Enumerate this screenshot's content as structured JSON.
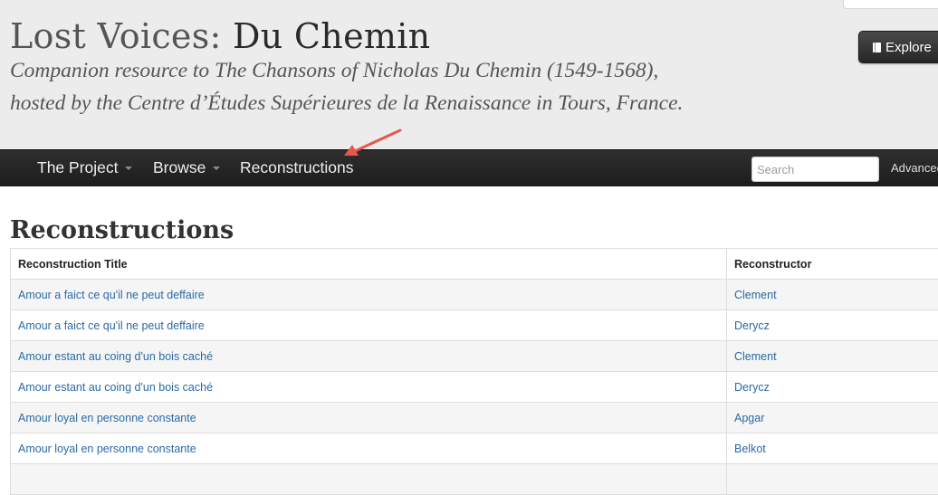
{
  "header": {
    "title_light": "Lost Voices: ",
    "title_strong": "Du Chemin",
    "subtitle_line1": "Companion resource to The Chansons of Nicholas Du Chemin (1549-1568),",
    "subtitle_line2": "hosted by the Centre d’Études Supérieures de la Renaissance in Tours, France.",
    "explore_label": "Explore"
  },
  "navbar": {
    "items": [
      {
        "label": "The Project",
        "dropdown": true
      },
      {
        "label": "Browse",
        "dropdown": true
      },
      {
        "label": "Reconstructions",
        "dropdown": false
      }
    ],
    "search_placeholder": "Search",
    "advanced_label": "Advanced"
  },
  "annotation": {
    "arrow_color": "#e8574d"
  },
  "main": {
    "heading": "Reconstructions",
    "table": {
      "columns": [
        "Reconstruction Title",
        "Reconstructor"
      ],
      "rows": [
        [
          "Amour a faict ce qu'il ne peut deffaire",
          "Clement"
        ],
        [
          "Amour a faict ce qu'il ne peut deffaire",
          "Derycz"
        ],
        [
          "Amour estant au coing d'un bois caché",
          "Clement"
        ],
        [
          "Amour estant au coing d'un bois caché",
          "Derycz"
        ],
        [
          "Amour loyal en personne constante",
          "Apgar"
        ],
        [
          "Amour loyal en personne constante",
          "Belkot"
        ]
      ]
    }
  },
  "colors": {
    "link": "#2a6aa8",
    "navbar": "#222222",
    "header_bg": "#ececec"
  }
}
